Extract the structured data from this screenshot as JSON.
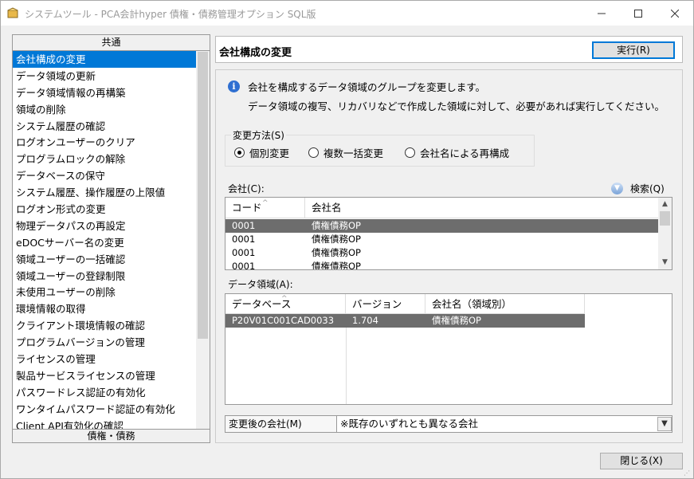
{
  "window": {
    "title": "システムツール - PCA会計hyper 債権・債務管理オプション SQL版",
    "min_icon": "minimize-icon",
    "max_icon": "maximize-icon",
    "close_icon": "close-icon"
  },
  "sidebar": {
    "header": "共通",
    "footer": "債権・債務",
    "items": [
      {
        "label": "会社構成の変更"
      },
      {
        "label": "データ領域の更新"
      },
      {
        "label": "データ領域情報の再構築"
      },
      {
        "label": "領域の削除"
      },
      {
        "label": "システム履歴の確認"
      },
      {
        "label": "ログオンユーザーのクリア"
      },
      {
        "label": "プログラムロックの解除"
      },
      {
        "label": "データベースの保守"
      },
      {
        "label": "システム履歴、操作履歴の上限値"
      },
      {
        "label": "ログオン形式の変更"
      },
      {
        "label": "物理データパスの再設定"
      },
      {
        "label": "eDOCサーバー名の変更"
      },
      {
        "label": "領域ユーザーの一括確認"
      },
      {
        "label": "領域ユーザーの登録制限"
      },
      {
        "label": "未使用ユーザーの削除"
      },
      {
        "label": "環境情報の取得"
      },
      {
        "label": "クライアント環境情報の確認"
      },
      {
        "label": "プログラムバージョンの管理"
      },
      {
        "label": "ライセンスの管理"
      },
      {
        "label": "製品サービスライセンスの管理"
      },
      {
        "label": "パスワードレス認証の有効化"
      },
      {
        "label": "ワンタイムパスワード認証の有効化"
      },
      {
        "label": "Client API有効化の確認"
      }
    ]
  },
  "main": {
    "title": "会社構成の変更",
    "execute_label": "実行(R)",
    "info_line1": "会社を構成するデータ領域のグループを変更します。",
    "info_line2": "データ領域の複写、リカバリなどで作成した領域に対して、必要があれば実行してください。",
    "method": {
      "legend": "変更方法(S)",
      "options": [
        "個別変更",
        "複数一括変更",
        "会社名による再構成"
      ],
      "selected": "個別変更"
    },
    "company": {
      "label": "会社(C):",
      "search_label": "検索(Q)",
      "columns": [
        "コード",
        "会社名"
      ],
      "rows": [
        {
          "code": "0001",
          "name": "債権債務OP"
        },
        {
          "code": "0001",
          "name": "債権債務OP"
        },
        {
          "code": "0001",
          "name": "債権債務OP"
        },
        {
          "code": "0001",
          "name": "債権債務OP"
        }
      ]
    },
    "data_area": {
      "label": "データ領域(A):",
      "columns": [
        "データベース",
        "バージョン",
        "会社名（領域別）"
      ],
      "rows": [
        {
          "db": "P20V01C001CAD0033",
          "version": "1.704",
          "name": "債権債務OP"
        }
      ]
    },
    "after_company": {
      "label": "変更後の会社(M)",
      "value": "※既存のいずれとも異なる会社"
    },
    "close_label": "閉じる(X)"
  },
  "colors": {
    "selection": "#0078d7",
    "grid_selected": "#6d6d6d",
    "background": "#f0f0f0"
  }
}
